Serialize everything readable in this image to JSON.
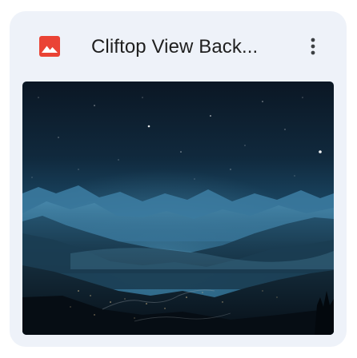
{
  "card": {
    "title": "Cliftop View Back...",
    "file_type_icon": "image-file-icon",
    "menu_icon": "more-vert-icon",
    "thumbnail_alt": "Night sky over misty mountain valley",
    "colors": {
      "card_background": "#eef2f9",
      "icon_red": "#ea4335",
      "title_text": "#1f1f1f"
    }
  }
}
